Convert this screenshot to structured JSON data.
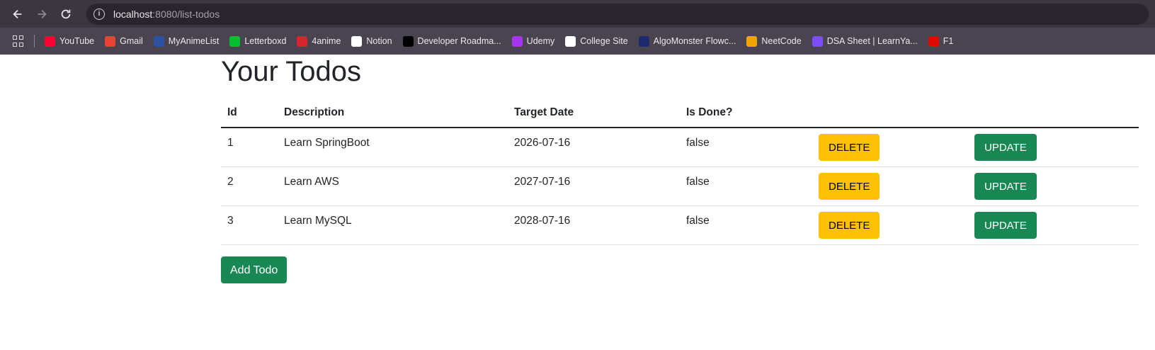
{
  "browser": {
    "url_host": "localhost",
    "url_path": ":8080/list-todos",
    "bookmarks": [
      {
        "label": "YouTube",
        "icon": "youtube-icon",
        "color": "#ff0033"
      },
      {
        "label": "Gmail",
        "icon": "gmail-icon",
        "color": "#ea4335"
      },
      {
        "label": "MyAnimeList",
        "icon": "myanimelist-icon",
        "color": "#2e51a2"
      },
      {
        "label": "Letterboxd",
        "icon": "letterboxd-icon",
        "color": "#00c030"
      },
      {
        "label": "4anime",
        "icon": "4anime-icon",
        "color": "#d9232d"
      },
      {
        "label": "Notion",
        "icon": "notion-icon",
        "color": "#ffffff"
      },
      {
        "label": "Developer Roadma...",
        "icon": "roadmap-icon",
        "color": "#000000"
      },
      {
        "label": "Udemy",
        "icon": "udemy-icon",
        "color": "#a435f0"
      },
      {
        "label": "College Site",
        "icon": "globe-icon",
        "color": "#ffffff"
      },
      {
        "label": "AlgoMonster Flowc...",
        "icon": "algomonster-icon",
        "color": "#1e2a6b"
      },
      {
        "label": "NeetCode",
        "icon": "neetcode-icon",
        "color": "#f0a500"
      },
      {
        "label": "DSA Sheet | LearnYa...",
        "icon": "learnyard-icon",
        "color": "#7b4dff"
      },
      {
        "label": "F1",
        "icon": "f1-icon",
        "color": "#e10600"
      }
    ]
  },
  "page": {
    "title": "Your Todos",
    "columns": [
      "Id",
      "Description",
      "Target Date",
      "Is Done?"
    ],
    "todos": [
      {
        "id": "1",
        "description": "Learn SpringBoot",
        "target_date": "2026-07-16",
        "done": "false",
        "delete_label": "DELETE",
        "update_label": "UPDATE"
      },
      {
        "id": "2",
        "description": "Learn AWS",
        "target_date": "2027-07-16",
        "done": "false",
        "delete_label": "DELETE",
        "update_label": "UPDATE"
      },
      {
        "id": "3",
        "description": "Learn MySQL",
        "target_date": "2028-07-16",
        "done": "false",
        "delete_label": "DELETE",
        "update_label": "UPDATE"
      }
    ],
    "add_label": "Add Todo"
  },
  "colors": {
    "warning": "#ffc107",
    "success": "#198754"
  }
}
